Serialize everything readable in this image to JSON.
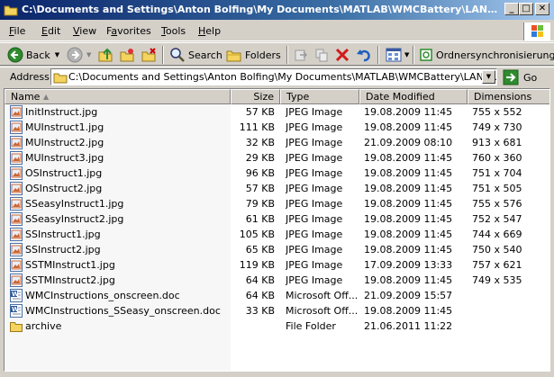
{
  "window": {
    "title": "C:\\Documents and Settings\\Anton Bolfing\\My Documents\\MATLAB\\WMCBattery\\LANGUAGES\\English",
    "min_glyph": "_",
    "max_glyph": "□",
    "close_glyph": "✕"
  },
  "menu": {
    "items": [
      {
        "pre": "",
        "u": "F",
        "post": "ile"
      },
      {
        "pre": "",
        "u": "E",
        "post": "dit"
      },
      {
        "pre": "",
        "u": "V",
        "post": "iew"
      },
      {
        "pre": "F",
        "u": "a",
        "post": "vorites"
      },
      {
        "pre": "",
        "u": "T",
        "post": "ools"
      },
      {
        "pre": "",
        "u": "H",
        "post": "elp"
      }
    ]
  },
  "toolbar": {
    "back_label": "Back",
    "search_label": "Search",
    "folders_label": "Folders",
    "sync_label": "Ordnersynchronisierung"
  },
  "address": {
    "label": "Address",
    "value": "C:\\Documents and Settings\\Anton Bolfing\\My Documents\\MATLAB\\WMCBattery\\LANGUAGES\\English",
    "go_label": "Go"
  },
  "columns": {
    "name": "Name",
    "size": "Size",
    "type": "Type",
    "date": "Date Modified",
    "dimensions": "Dimensions"
  },
  "files": [
    {
      "name": "InitInstruct.jpg",
      "size": "57 KB",
      "type": "JPEG Image",
      "date": "19.08.2009 11:45",
      "dim": "755 x 552",
      "kind": "jpg"
    },
    {
      "name": "MUInstruct1.jpg",
      "size": "111 KB",
      "type": "JPEG Image",
      "date": "19.08.2009 11:45",
      "dim": "749 x 730",
      "kind": "jpg"
    },
    {
      "name": "MUInstruct2.jpg",
      "size": "32 KB",
      "type": "JPEG Image",
      "date": "21.09.2009 08:10",
      "dim": "913 x 681",
      "kind": "jpg"
    },
    {
      "name": "MUInstruct3.jpg",
      "size": "29 KB",
      "type": "JPEG Image",
      "date": "19.08.2009 11:45",
      "dim": "760 x 360",
      "kind": "jpg"
    },
    {
      "name": "OSInstruct1.jpg",
      "size": "96 KB",
      "type": "JPEG Image",
      "date": "19.08.2009 11:45",
      "dim": "751 x 704",
      "kind": "jpg"
    },
    {
      "name": "OSInstruct2.jpg",
      "size": "57 KB",
      "type": "JPEG Image",
      "date": "19.08.2009 11:45",
      "dim": "751 x 505",
      "kind": "jpg"
    },
    {
      "name": "SSeasyInstruct1.jpg",
      "size": "79 KB",
      "type": "JPEG Image",
      "date": "19.08.2009 11:45",
      "dim": "755 x 576",
      "kind": "jpg"
    },
    {
      "name": "SSeasyInstruct2.jpg",
      "size": "61 KB",
      "type": "JPEG Image",
      "date": "19.08.2009 11:45",
      "dim": "752 x 547",
      "kind": "jpg"
    },
    {
      "name": "SSInstruct1.jpg",
      "size": "105 KB",
      "type": "JPEG Image",
      "date": "19.08.2009 11:45",
      "dim": "744 x 669",
      "kind": "jpg"
    },
    {
      "name": "SSInstruct2.jpg",
      "size": "65 KB",
      "type": "JPEG Image",
      "date": "19.08.2009 11:45",
      "dim": "750 x 540",
      "kind": "jpg"
    },
    {
      "name": "SSTMInstruct1.jpg",
      "size": "119 KB",
      "type": "JPEG Image",
      "date": "17.09.2009 13:33",
      "dim": "757 x 621",
      "kind": "jpg"
    },
    {
      "name": "SSTMInstruct2.jpg",
      "size": "64 KB",
      "type": "JPEG Image",
      "date": "19.08.2009 11:45",
      "dim": "749 x 535",
      "kind": "jpg"
    },
    {
      "name": "WMCInstructions_onscreen.doc",
      "size": "64 KB",
      "type": "Microsoft Off...",
      "date": "21.09.2009 15:57",
      "dim": "",
      "kind": "doc"
    },
    {
      "name": "WMCInstructions_SSeasy_onscreen.doc",
      "size": "33 KB",
      "type": "Microsoft Off...",
      "date": "19.08.2009 11:45",
      "dim": "",
      "kind": "doc"
    },
    {
      "name": "archive",
      "size": "",
      "type": "File Folder",
      "date": "21.06.2011 11:22",
      "dim": "",
      "kind": "folder"
    }
  ],
  "icons": {
    "window": "folder-icon",
    "back": "back-arrow-icon",
    "forward": "forward-arrow-icon",
    "up": "up-folder-icon",
    "search": "search-icon",
    "folders": "folders-icon",
    "delete": "delete-icon",
    "undo": "undo-icon",
    "views": "views-icon",
    "sync": "sync-icon",
    "go": "go-arrow-icon"
  },
  "colors": {
    "title_start": "#0a246a",
    "title_end": "#a6caf0",
    "face": "#d4d0c8",
    "go_green": "#2e8b2e"
  }
}
